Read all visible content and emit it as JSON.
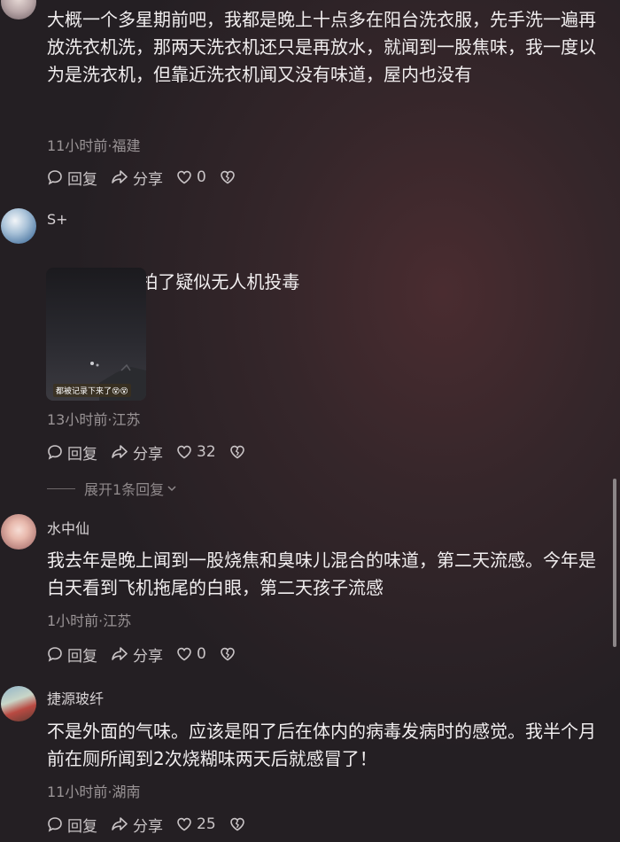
{
  "comments": [
    {
      "text": "大概一个多星期前吧，我都是晚上十点多在阳台洗衣服，先手洗一遍再放洗衣机洗，那两天洗衣机还只是再放水，就闻到一股焦味，我一度以为是洗衣机，但靠近洗衣机闻又没有味道，屋内也没有",
      "meta": "11小时前·福建",
      "reply_label": "回复",
      "share_label": "分享",
      "likes": "0"
    },
    {
      "username": "S+",
      "text": "有人晚上拍了疑似无人机投毒",
      "image_caption": "都被记录下来了😵😵",
      "meta": "13小时前·江苏",
      "reply_label": "回复",
      "share_label": "分享",
      "likes": "32",
      "expand_replies": "展开1条回复"
    },
    {
      "username": "水中仙",
      "text": "我去年是晚上闻到一股烧焦和臭味儿混合的味道，第二天流感。今年是白天看到飞机拖尾的白眼，第二天孩子流感",
      "meta": "1小时前·江苏",
      "reply_label": "回复",
      "share_label": "分享",
      "likes": "0"
    },
    {
      "username": "捷源玻纤",
      "text": "不是外面的气味。应该是阳了后在体内的病毒发病时的感觉。我半个月前在厕所闻到2次烧糊味两天后就感冒了！",
      "meta": "11小时前·湖南",
      "reply_label": "回复",
      "share_label": "分享",
      "likes": "25"
    }
  ]
}
